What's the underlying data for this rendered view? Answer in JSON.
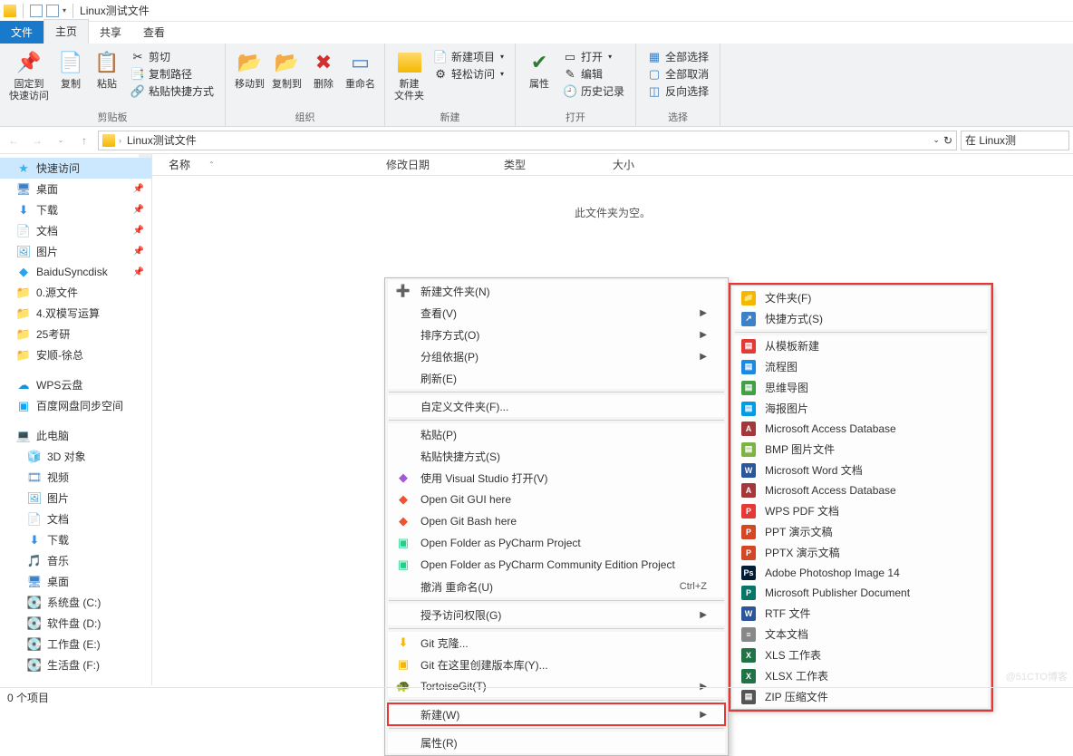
{
  "title": "Linux测试文件",
  "tabs": {
    "file": "文件",
    "home": "主页",
    "share": "共享",
    "view": "查看"
  },
  "ribbon": {
    "pin": "固定到\n快速访问",
    "copy": "复制",
    "paste": "粘贴",
    "cut": "剪切",
    "copypath": "复制路径",
    "pasteshortcut": "粘贴快捷方式",
    "clipboard": "剪贴板",
    "moveto": "移动到",
    "copyto": "复制到",
    "delete": "删除",
    "rename": "重命名",
    "organize": "组织",
    "newfolder": "新建\n文件夹",
    "newitem": "新建项目",
    "easyaccess": "轻松访问",
    "new": "新建",
    "properties": "属性",
    "open": "打开",
    "edit": "编辑",
    "history": "历史记录",
    "opengrp": "打开",
    "selectall": "全部选择",
    "selectnone": "全部取消",
    "invert": "反向选择",
    "select": "选择"
  },
  "breadcrumb": {
    "label": "Linux测试文件"
  },
  "search_placeholder": "在 Linux测",
  "columns": {
    "name": "名称",
    "date": "修改日期",
    "type": "类型",
    "size": "大小"
  },
  "empty": "此文件夹为空。",
  "status": "0 个项目",
  "watermark": "@51CTO博客",
  "sidebar": [
    {
      "label": "快速访问",
      "icon": "★",
      "color": "#3db0ef",
      "selected": true
    },
    {
      "label": "桌面",
      "icon": "🖥",
      "color": "#3b82c8",
      "pin": true
    },
    {
      "label": "下载",
      "icon": "⬇",
      "color": "#2f8fea",
      "pin": true
    },
    {
      "label": "文档",
      "icon": "📄",
      "color": "#6aa0d8",
      "pin": true
    },
    {
      "label": "图片",
      "icon": "🖼",
      "color": "#4aa8d8",
      "pin": true
    },
    {
      "label": "BaiduSyncdisk",
      "icon": "◆",
      "color": "#2aa3ef",
      "pin": true
    },
    {
      "label": "0.源文件",
      "icon": "📁",
      "color": "#f4b800"
    },
    {
      "label": "4.双模写运算",
      "icon": "📁",
      "color": "#f4b800"
    },
    {
      "label": "25考研",
      "icon": "📁",
      "color": "#f4b800"
    },
    {
      "label": "安顺-徐总",
      "icon": "📁",
      "color": "#f4b800"
    },
    {
      "sep": true
    },
    {
      "label": "WPS云盘",
      "icon": "☁",
      "color": "#1296db"
    },
    {
      "label": "百度网盘同步空间",
      "icon": "▣",
      "color": "#06a7ff"
    },
    {
      "sep": true
    },
    {
      "label": "此电脑",
      "icon": "💻",
      "color": "#3b82c8"
    },
    {
      "label": "3D 对象",
      "icon": "🧊",
      "color": "#3bb6e6",
      "indent": true
    },
    {
      "label": "视频",
      "icon": "🎞",
      "color": "#5a8fbf",
      "indent": true
    },
    {
      "label": "图片",
      "icon": "🖼",
      "color": "#4aa8d8",
      "indent": true
    },
    {
      "label": "文档",
      "icon": "📄",
      "color": "#6aa0d8",
      "indent": true
    },
    {
      "label": "下载",
      "icon": "⬇",
      "color": "#2f8fea",
      "indent": true
    },
    {
      "label": "音乐",
      "icon": "🎵",
      "color": "#4aa8d8",
      "indent": true
    },
    {
      "label": "桌面",
      "icon": "🖥",
      "color": "#3b82c8",
      "indent": true
    },
    {
      "label": "系统盘 (C:)",
      "icon": "💽",
      "color": "#9aa",
      "indent": true
    },
    {
      "label": "软件盘 (D:)",
      "icon": "💽",
      "color": "#9aa",
      "indent": true
    },
    {
      "label": "工作盘 (E:)",
      "icon": "💽",
      "color": "#9aa",
      "indent": true
    },
    {
      "label": "生活盘 (F:)",
      "icon": "💽",
      "color": "#9aa",
      "indent": true
    }
  ],
  "ctx1": [
    {
      "label": "新建文件夹(N)",
      "icon": "➕",
      "iconbg": "#1e88e5"
    },
    {
      "label": "查看(V)",
      "sub": true
    },
    {
      "label": "排序方式(O)",
      "sub": true
    },
    {
      "label": "分组依据(P)",
      "sub": true
    },
    {
      "label": "刷新(E)"
    },
    {
      "sep": true
    },
    {
      "label": "自定义文件夹(F)..."
    },
    {
      "sep": true
    },
    {
      "label": "粘贴(P)",
      "disabled": true
    },
    {
      "label": "粘贴快捷方式(S)",
      "disabled": true
    },
    {
      "label": "使用 Visual Studio 打开(V)",
      "icon": "◆",
      "iconbg": "#a259d9"
    },
    {
      "label": "Open Git GUI here",
      "icon": "◆",
      "iconbg": "#f05033"
    },
    {
      "label": "Open Git Bash here",
      "icon": "◆",
      "iconbg": "#f05033"
    },
    {
      "label": "Open Folder as PyCharm Project",
      "icon": "▣",
      "iconbg": "#20d18c"
    },
    {
      "label": "Open Folder as PyCharm Community Edition Project",
      "icon": "▣",
      "iconbg": "#20d18c"
    },
    {
      "label": "撤消 重命名(U)",
      "shortcut": "Ctrl+Z"
    },
    {
      "sep": true
    },
    {
      "label": "授予访问权限(G)",
      "sub": true
    },
    {
      "sep": true
    },
    {
      "label": "Git 克隆...",
      "icon": "⬇",
      "iconbg": "#f4b800"
    },
    {
      "label": "Git 在这里创建版本库(Y)...",
      "icon": "▣",
      "iconbg": "#f4b800"
    },
    {
      "label": "TortoiseGit(T)",
      "icon": "🐢",
      "iconbg": "#4caf50",
      "sub": true
    },
    {
      "sep": true
    },
    {
      "label": "新建(W)",
      "sub": true,
      "highlight": true
    },
    {
      "sep": true
    },
    {
      "label": "属性(R)"
    }
  ],
  "ctx2": [
    {
      "label": "文件夹(F)",
      "icon": "📁",
      "color": "#f4b800"
    },
    {
      "label": "快捷方式(S)",
      "icon": "↗",
      "color": "#3b82c8"
    },
    {
      "sep": true
    },
    {
      "label": "从模板新建",
      "icon": "▤",
      "color": "#e53935"
    },
    {
      "label": "流程图",
      "icon": "▤",
      "color": "#1e88e5"
    },
    {
      "label": "思维导图",
      "icon": "▤",
      "color": "#43a047"
    },
    {
      "label": "海报图片",
      "icon": "▤",
      "color": "#039be5"
    },
    {
      "label": "Microsoft Access Database",
      "icon": "A",
      "color": "#a4373a"
    },
    {
      "label": "BMP 图片文件",
      "icon": "▤",
      "color": "#7cb342"
    },
    {
      "label": "Microsoft Word 文档",
      "icon": "W",
      "color": "#2b579a"
    },
    {
      "label": "Microsoft Access Database",
      "icon": "A",
      "color": "#a4373a"
    },
    {
      "label": "WPS PDF 文档",
      "icon": "P",
      "color": "#e53935"
    },
    {
      "label": "PPT 演示文稿",
      "icon": "P",
      "color": "#d24726"
    },
    {
      "label": "PPTX 演示文稿",
      "icon": "P",
      "color": "#d24726"
    },
    {
      "label": "Adobe Photoshop Image 14",
      "icon": "Ps",
      "color": "#001e36"
    },
    {
      "label": "Microsoft Publisher Document",
      "icon": "P",
      "color": "#077568"
    },
    {
      "label": "RTF 文件",
      "icon": "W",
      "color": "#2b579a"
    },
    {
      "label": "文本文档",
      "icon": "≡",
      "color": "#888"
    },
    {
      "label": "XLS 工作表",
      "icon": "X",
      "color": "#217346"
    },
    {
      "label": "XLSX 工作表",
      "icon": "X",
      "color": "#217346"
    },
    {
      "label": "ZIP 压缩文件",
      "icon": "▤",
      "color": "#555"
    }
  ]
}
